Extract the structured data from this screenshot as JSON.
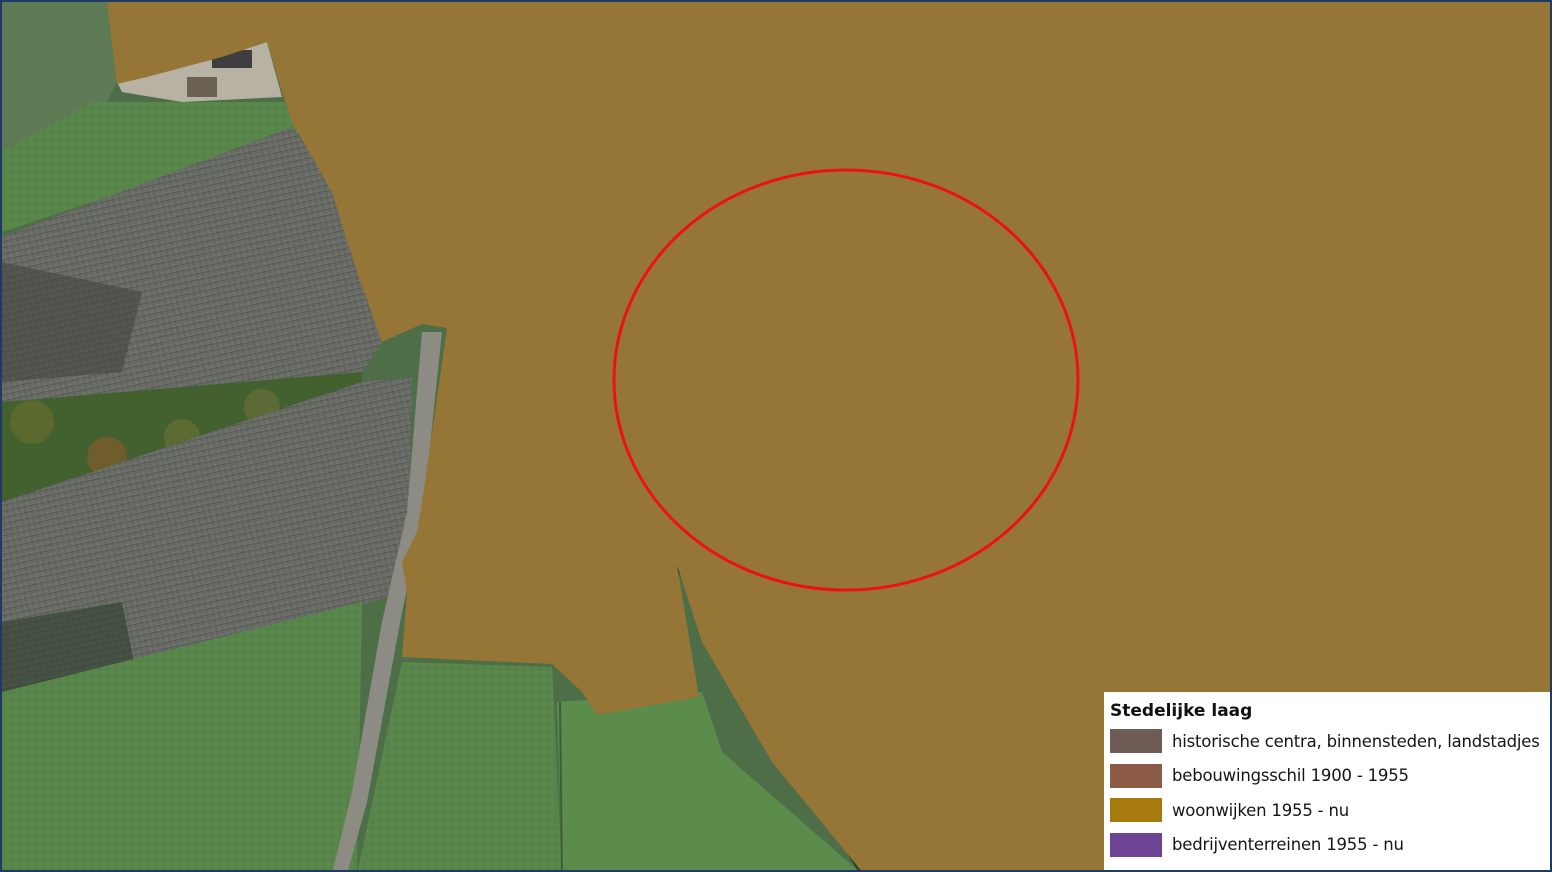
{
  "map": {
    "overlay_color": "#957637",
    "highlight_circle_color": "#ee1111",
    "frame_color": "#1f3a63",
    "basemap": "aerial-photo"
  },
  "legend": {
    "title": "Stedelijke laag",
    "items": [
      {
        "label": "historische centra, binnensteden, landstadjes",
        "color": "#6f5d55"
      },
      {
        "label": "bebouwingsschil 1900 - 1955",
        "color": "#8b5b45"
      },
      {
        "label": "woonwijken 1955 - nu",
        "color": "#a77a10"
      },
      {
        "label": "bedrijventerreinen 1955 - nu",
        "color": "#6d4394"
      }
    ]
  }
}
